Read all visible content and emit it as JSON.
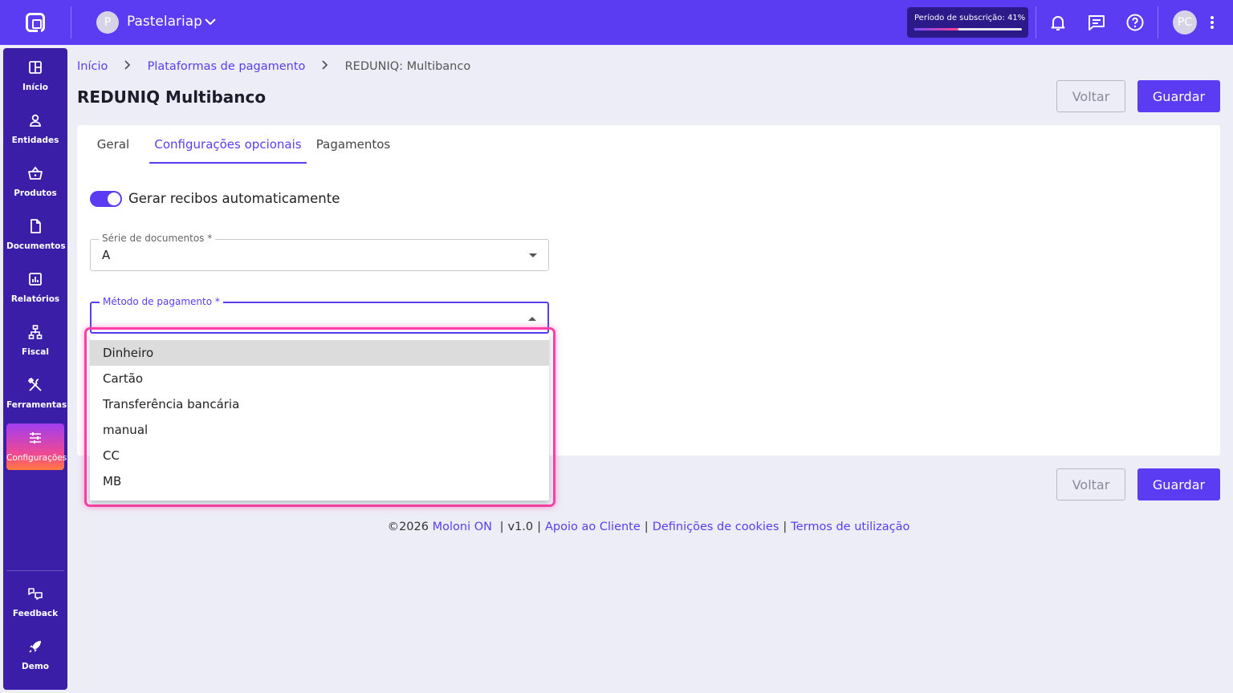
{
  "topbar": {
    "company_initial": "P",
    "company_name": "Pastelariap",
    "subscription_label": "Período de subscrição: 41%",
    "subscription_percent": 41,
    "user_initials": "PC"
  },
  "sidebar": {
    "items": [
      {
        "label": "Início",
        "icon": "dashboard-icon"
      },
      {
        "label": "Entidades",
        "icon": "user-icon"
      },
      {
        "label": "Produtos",
        "icon": "basket-icon"
      },
      {
        "label": "Documentos",
        "icon": "document-icon"
      },
      {
        "label": "Relatórios",
        "icon": "chart-icon"
      },
      {
        "label": "Fiscal",
        "icon": "hierarchy-icon"
      },
      {
        "label": "Ferramentas",
        "icon": "tools-icon"
      },
      {
        "label": "Configurações",
        "icon": "sliders-icon",
        "active": true
      }
    ],
    "bottom_items": [
      {
        "label": "Feedback",
        "icon": "feedback-icon"
      },
      {
        "label": "Demo",
        "icon": "rocket-icon"
      }
    ]
  },
  "breadcrumb": {
    "items": [
      "Início",
      "Plataformas de pagamento",
      "REDUNIQ: Multibanco"
    ]
  },
  "page": {
    "title": "REDUNIQ Multibanco",
    "back_label": "Voltar",
    "save_label": "Guardar"
  },
  "tabs": [
    {
      "label": "Geral"
    },
    {
      "label": "Configurações opcionais",
      "active": true
    },
    {
      "label": "Pagamentos"
    }
  ],
  "form": {
    "auto_receipts_label": "Gerar recibos automaticamente",
    "auto_receipts_on": true,
    "series_label": "Série de documentos *",
    "series_value": "A",
    "payment_method_label": "Método de pagamento *",
    "payment_method_value": ""
  },
  "dropdown": {
    "options": [
      "Dinheiro",
      "Cartão",
      "Transferência bancária",
      "manual",
      "CC",
      "MB"
    ],
    "hovered_index": 0
  },
  "footer": {
    "copyright": "©2026",
    "brand": "Moloni ON",
    "version": "v1.0",
    "support": "Apoio ao Cliente",
    "cookies": "Definições de cookies",
    "terms": "Termos de utilização"
  },
  "colors": {
    "primary": "#5b3cf2",
    "sidebar": "#3a1ea8",
    "highlight": "#ff3fa8"
  }
}
